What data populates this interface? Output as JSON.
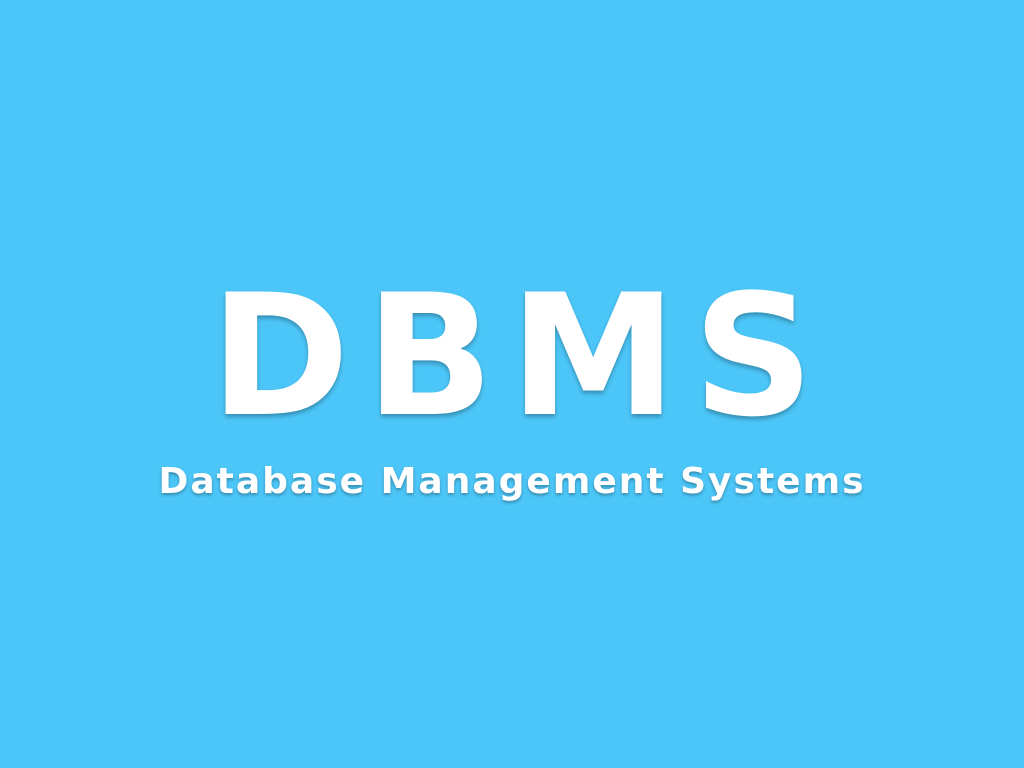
{
  "slide": {
    "title": "DBMS",
    "subtitle": "Database Management Systems",
    "background_color": "#4cc6f8",
    "text_color": "#ffffff"
  }
}
